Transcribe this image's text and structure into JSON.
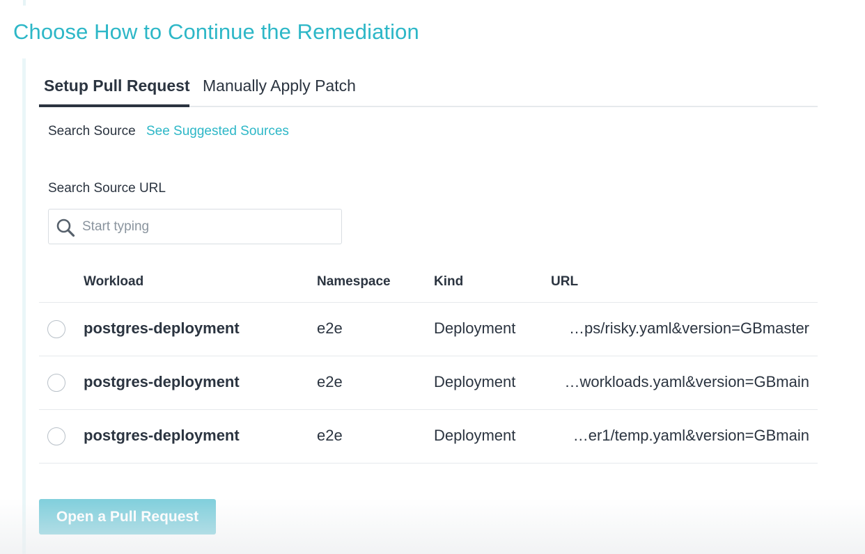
{
  "page": {
    "title": "Choose How to Continue the Remediation"
  },
  "tabs": [
    {
      "label": "Setup Pull Request",
      "active": true
    },
    {
      "label": "Manually Apply Patch",
      "active": false
    }
  ],
  "source": {
    "label": "Search Source",
    "link": "See Suggested Sources"
  },
  "search": {
    "label": "Search Source URL",
    "placeholder": "Start typing",
    "value": "",
    "icon": "search-icon"
  },
  "table": {
    "headers": [
      "Workload",
      "Namespace",
      "Kind",
      "URL"
    ],
    "rows": [
      {
        "workload": "postgres-deployment",
        "namespace": "e2e",
        "kind": "Deployment",
        "url": "…ps/risky.yaml&version=GBmaster",
        "selected": false
      },
      {
        "workload": "postgres-deployment",
        "namespace": "e2e",
        "kind": "Deployment",
        "url": "…workloads.yaml&version=GBmain",
        "selected": false
      },
      {
        "workload": "postgres-deployment",
        "namespace": "e2e",
        "kind": "Deployment",
        "url": "…er1/temp.yaml&version=GBmain",
        "selected": false
      }
    ]
  },
  "actions": {
    "open_pr": "Open a Pull Request"
  },
  "colors": {
    "accent": "#2db7c7",
    "text": "#2b3440",
    "button_disabled": "#80cfdc"
  }
}
